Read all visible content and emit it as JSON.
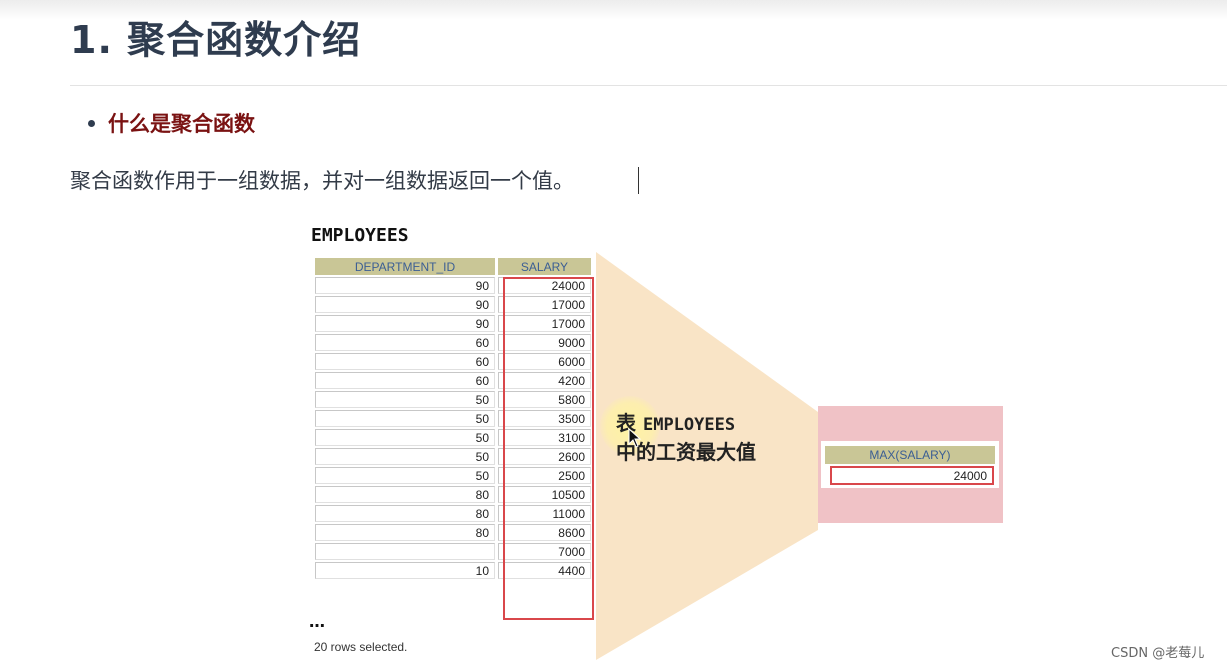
{
  "heading": "1. 聚合函数介绍",
  "subheading": "什么是聚合函数",
  "intro": "聚合函数作用于一组数据，并对一组数据返回一个值。",
  "figure": {
    "table_title": "EMPLOYEES",
    "columns": [
      "DEPARTMENT_ID",
      "SALARY"
    ],
    "rows": [
      [
        "90",
        "24000"
      ],
      [
        "90",
        "17000"
      ],
      [
        "90",
        "17000"
      ],
      [
        "60",
        "9000"
      ],
      [
        "60",
        "6000"
      ],
      [
        "60",
        "4200"
      ],
      [
        "50",
        "5800"
      ],
      [
        "50",
        "3500"
      ],
      [
        "50",
        "3100"
      ],
      [
        "50",
        "2600"
      ],
      [
        "50",
        "2500"
      ],
      [
        "80",
        "10500"
      ],
      [
        "80",
        "11000"
      ],
      [
        "80",
        "8600"
      ],
      [
        "",
        "7000"
      ],
      [
        "10",
        "4400"
      ]
    ],
    "ellipsis": "…",
    "rows_selected": "20 rows selected.",
    "callout_prefix": "表",
    "callout_table": "EMPLOYEES",
    "callout_line2": "中的工资最大值",
    "result_header": "MAX(SALARY)",
    "result_value": "24000"
  },
  "watermark": "CSDN @老莓儿",
  "colors": {
    "heading": "#2f3c4f",
    "subheading": "#7a1212",
    "table_header_bg": "#c9c696",
    "table_header_text": "#3b5e94",
    "highlight_border": "#d9474b",
    "funnel_fill": "#f9e4c6",
    "result_bg": "#f0c2c6"
  },
  "icons": [
    "mouse-cursor-icon"
  ]
}
